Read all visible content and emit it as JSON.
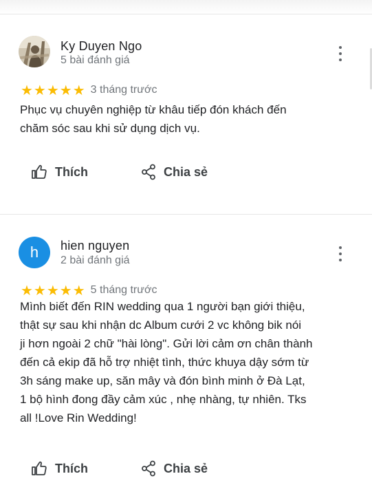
{
  "reviews": [
    {
      "reviewer": "Ky Duyen Ngo",
      "review_count": "5 bài đánh giá",
      "rating": 5,
      "stars": "★★★★★",
      "time": "3 tháng trước",
      "text": "Phục vụ chuyên nghiệp từ khâu tiếp đón khách đến\nchăm sóc sau khi sử dụng dịch vụ.",
      "avatar_type": "photo",
      "like_label": "Thích",
      "share_label": "Chia sẻ"
    },
    {
      "reviewer": "hien nguyen",
      "review_count": "2 bài đánh giá",
      "rating": 5,
      "stars": "★★★★★",
      "time": "5 tháng trước",
      "text": "Mình biết đến RIN wedding qua 1 người bạn giới thiệu,\nthật sự sau khi nhận dc Album cưới 2 vc không bik nói\nji hơn ngoài 2 chữ \"hài lòng\". Gửi lời cảm ơn chân thành\nđến cả ekip đã hỗ trợ nhiệt tình, thức khuya dậy sớm từ\n3h sáng make up, săn mây và đón bình minh ở Đà Lạt,\n1 bộ hình đong đầy cảm xúc , nhẹ nhàng, tự nhiên. Tks\nall !Love Rin Wedding!",
      "avatar_type": "letter",
      "avatar_letter": "h",
      "avatar_color": "#1a8fe3",
      "like_label": "Thích",
      "share_label": "Chia sẻ"
    }
  ],
  "icons": {
    "more": "more-vert-icon",
    "like": "thumb-up-icon",
    "share": "share-icon"
  },
  "colors": {
    "star": "#fbbc04",
    "secondary_text": "#70757a",
    "action_text": "#3c4043"
  }
}
